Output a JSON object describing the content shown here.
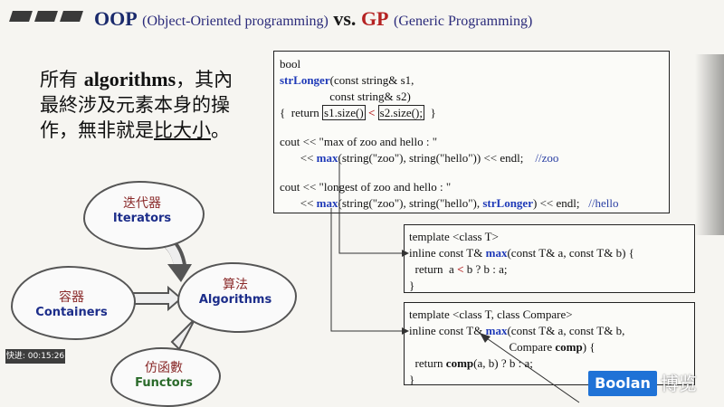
{
  "slide": {
    "title": {
      "oop": "OOP",
      "oop_full": "(Object-Oriented programming)",
      "vs": "vs.",
      "gp": "GP",
      "gp_full": "(Generic Programming)"
    },
    "chinese_text": {
      "line1_a": "所有 ",
      "line1_b": "algorithms",
      "line1_c": "，其內",
      "line2": "最終涉及元素本身的操",
      "line3_a": "作，無非就是",
      "line3_b": "比大小",
      "line3_c": "。"
    },
    "main_code": {
      "l1": "bool",
      "l2_fn": "strLonger",
      "l2_rest": "(const string& s1,",
      "l3": "                 const string& s2)",
      "l4_a": "{  return ",
      "l4_b": "s1.size()",
      "l4_c": " < ",
      "l4_d": "s2.size();",
      "l4_e": "  }",
      "l5": "cout << \"max of zoo and hello : \"",
      "l6_a": "       << ",
      "l6_b": "max",
      "l6_c": "(string(\"zoo\"), string(\"hello\")) << endl;    ",
      "l6_d": "//zoo",
      "l7": "cout << \"longest of zoo and hello : \"",
      "l8_a": "       << ",
      "l8_b": "max",
      "l8_c": "(string(\"zoo\"), string(\"hello\"), ",
      "l8_d": "strLonger",
      "l8_e": ") << endl;   ",
      "l8_f": "//hello"
    },
    "template1": {
      "l1": "template <class T>",
      "l2_a": "inline const T& ",
      "l2_b": "max",
      "l2_c": "(const T& a, const T& b) {",
      "l3_a": "  return  a ",
      "l3_b": "<",
      "l3_c": " b ? b : a;",
      "l4": "}"
    },
    "template2": {
      "l1": "template <class T, class Compare>",
      "l2_a": "inline const T& ",
      "l2_b": "max",
      "l2_c": "(const T& a, const T& b,",
      "l3_a": "                                  Compare ",
      "l3_b": "comp",
      "l3_c": ") {",
      "l4_a": "  return ",
      "l4_b": "comp",
      "l4_c": "(a, b) ? b : a;",
      "l5": "}"
    },
    "clouds": {
      "iterators_cn": "迭代器",
      "iterators_en": "Iterators",
      "containers_cn": "容器",
      "containers_en": "Containers",
      "algorithms_cn": "算法",
      "algorithms_en": "Algorithms",
      "functors_cn": "仿函數",
      "functors_en": "Functors"
    }
  },
  "overlay": {
    "speed_badge": "快进: 00:15:26",
    "logo_en": "Boolan",
    "logo_cn": "博览"
  }
}
